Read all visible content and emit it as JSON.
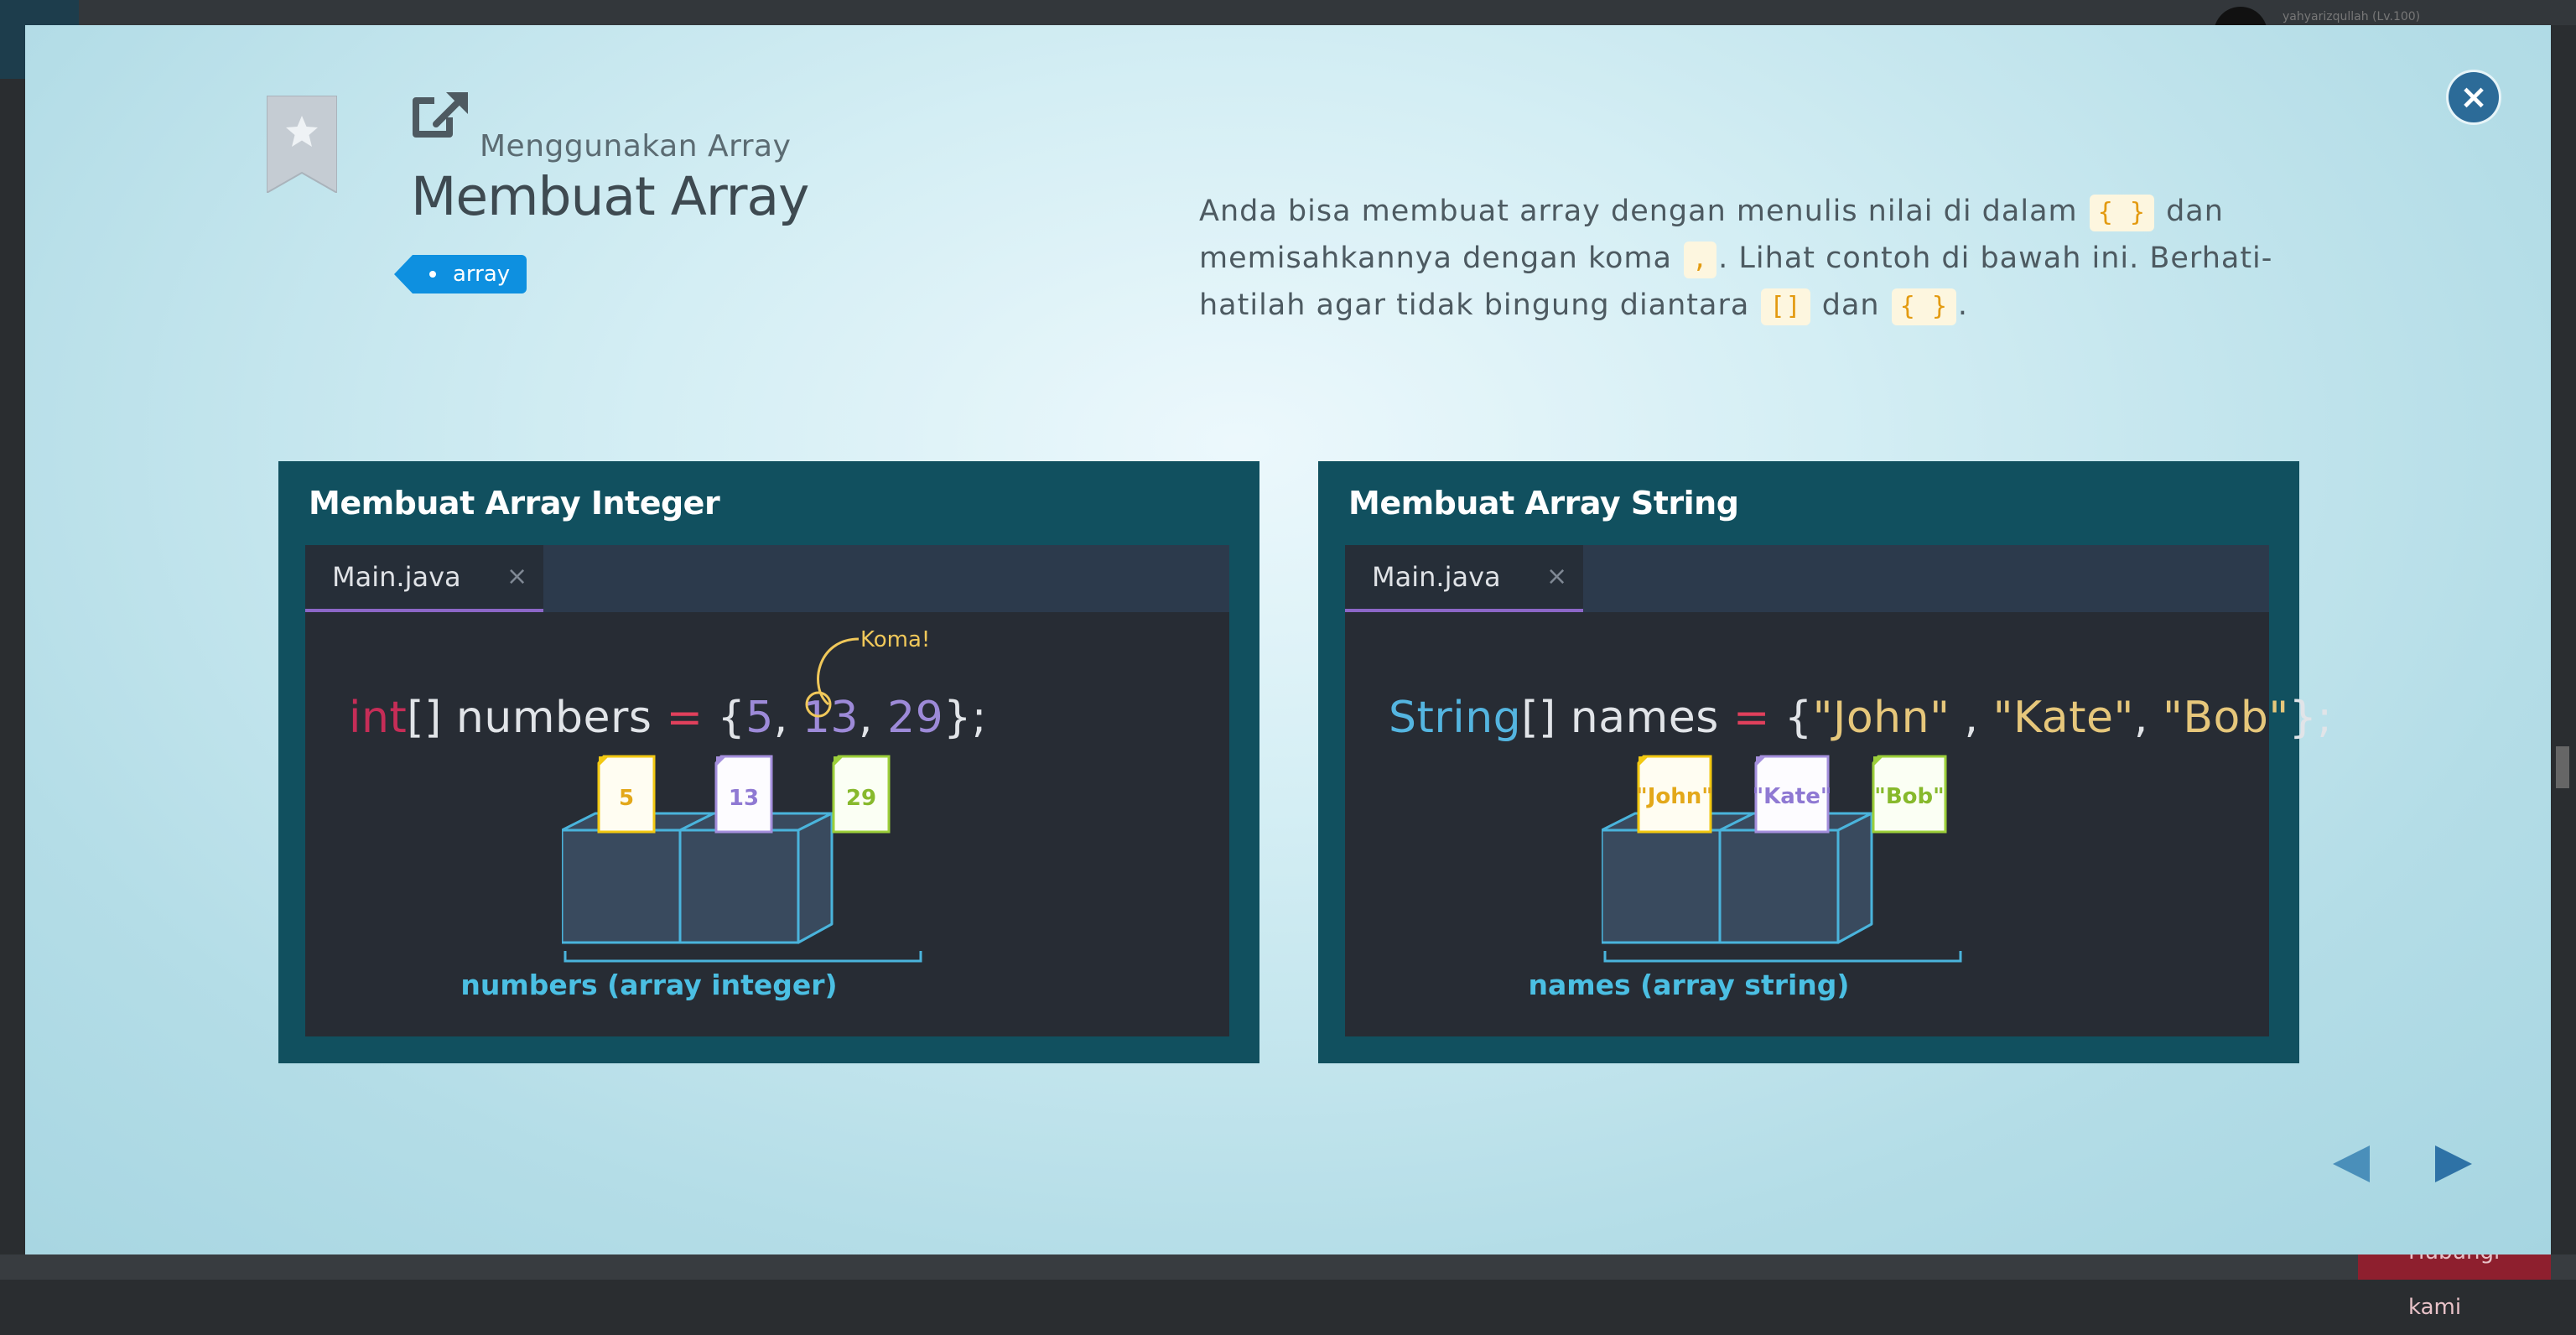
{
  "background": {
    "username": "yahyarizqullah (Lv.100)",
    "floating_button": "Hubungi kami"
  },
  "modal": {
    "close_label": "×",
    "section": "Menggunakan Array",
    "title": "Membuat Array",
    "tag": "array",
    "description": {
      "part1": "Anda bisa membuat array dengan menulis nilai di dalam",
      "chip1": "{ }",
      "part2": "dan memisahkannya dengan koma",
      "chip2": ",",
      "part3": ". Lihat contoh di bawah ini. Berhati-hatilah agar tidak bingung diantara",
      "chip3": "[]",
      "part4": "dan",
      "chip4": "{ }",
      "part5": "."
    },
    "slides": [
      {
        "title": "Membuat Array Integer",
        "tab": "Main.java",
        "tab_close": "×",
        "code": {
          "type": "int",
          "brackets": "[] ",
          "name": "numbers ",
          "eq": "= ",
          "open": "{",
          "v1": "5",
          "c1": ", ",
          "v2": "13",
          "c2": ", ",
          "v3": "29",
          "close": "};"
        },
        "annotation": "Koma!",
        "cards": [
          "5",
          "13",
          "29"
        ],
        "array_label": "numbers (array integer)"
      },
      {
        "title": "Membuat Array String",
        "tab": "Main.java",
        "tab_close": "×",
        "code": {
          "type": "String",
          "brackets": "[] ",
          "name": "names ",
          "eq": "= ",
          "open": "{",
          "v1": "\"John\"",
          "c1": " , ",
          "v2": "\"Kate\"",
          "c2": ", ",
          "v3": "\"Bob\"",
          "close": "};"
        },
        "cards": [
          "\"John\"",
          "\"Kate\"",
          "\"Bob\""
        ],
        "array_label": "names (array string)"
      }
    ],
    "colors": {
      "card1": "#f2c812",
      "card2": "#a48fdc",
      "card3": "#9ccf3a",
      "box_stroke": "#4ab4dc",
      "box_fill": "#394a5e",
      "accent_blue": "#0e90e0",
      "slide_bg": "#11505f"
    }
  }
}
